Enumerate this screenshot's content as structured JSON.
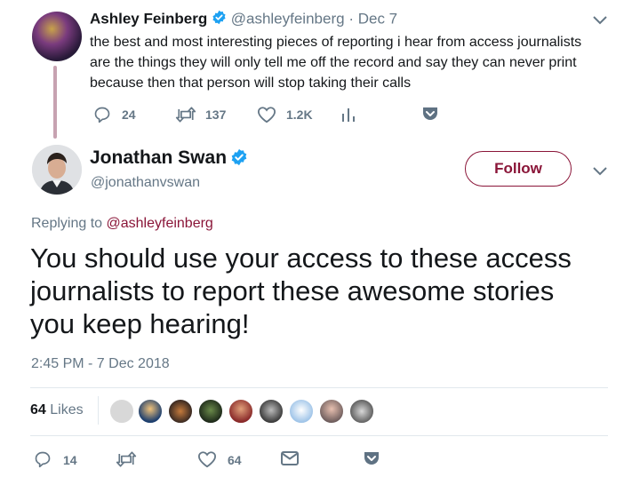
{
  "parent_tweet": {
    "name": "Ashley Feinberg",
    "handle": "@ashleyfeinberg",
    "separator": "·",
    "date": "Dec 7",
    "lines": [
      "the best and most interesting pieces of reporting i hear from access journalists",
      "are the things they will only tell me off the record and say they can never print",
      "because then that person will stop taking their calls"
    ],
    "actions": {
      "replies": "24",
      "retweets": "137",
      "likes": "1.2K"
    }
  },
  "main_tweet": {
    "name": "Jonathan Swan",
    "handle": "@jonathanvswan",
    "follow_label": "Follow",
    "replying_prefix": "Replying to",
    "replying_handle": "@ashleyfeinberg",
    "text_lines": [
      "You should use your access to these access",
      "journalists to report these awesome stories",
      "you keep hearing!"
    ],
    "timestamp": "2:45 PM - 7 Dec 2018",
    "likes_count": "64",
    "likes_label": "Likes",
    "actions": {
      "replies": "14",
      "likes": "64"
    }
  },
  "icons": {
    "verified": "verified-badge-icon",
    "chevron": "chevron-down-icon",
    "reply": "reply-icon",
    "retweet": "retweet-icon",
    "like": "heart-icon",
    "analytics": "analytics-icon",
    "pocket": "pocket-icon",
    "message": "direct-message-icon"
  },
  "colors": {
    "accent": "#8a1538",
    "verified": "#1da1f2",
    "muted": "#657786",
    "pocket": "#5f7283"
  }
}
